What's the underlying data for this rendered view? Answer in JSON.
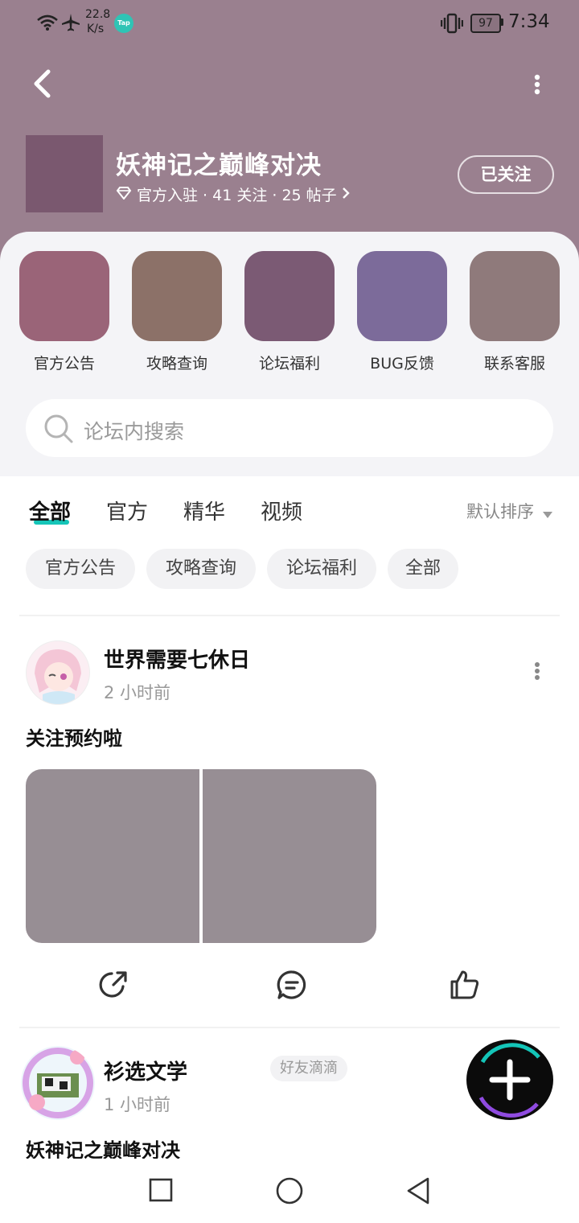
{
  "status_bar": {
    "net_speed_value": "22.8",
    "net_speed_unit": "K/s",
    "app_badge": "Tap",
    "battery": "97",
    "time": "7:34"
  },
  "header": {
    "forum_name": "妖神记之巅峰对决",
    "meta": "官方入驻 · 41 关注 · 25 帖子",
    "follow_button": "已关注"
  },
  "shortcuts": [
    {
      "label": "官方公告",
      "color": "#9a6478"
    },
    {
      "label": "攻略查询",
      "color": "#8c7168"
    },
    {
      "label": "论坛福利",
      "color": "#7b5a74"
    },
    {
      "label": "BUG反馈",
      "color": "#7c6b9a"
    },
    {
      "label": "联系客服",
      "color": "#8f7a7b"
    }
  ],
  "search": {
    "placeholder": "论坛内搜索"
  },
  "tabs": [
    {
      "label": "全部",
      "active": true
    },
    {
      "label": "官方",
      "active": false
    },
    {
      "label": "精华",
      "active": false
    },
    {
      "label": "视频",
      "active": false
    }
  ],
  "sort_label": "默认排序",
  "chips": [
    "官方公告",
    "攻略查询",
    "论坛福利",
    "全部"
  ],
  "posts": [
    {
      "author": "世界需要七休日",
      "time": "2 小时前",
      "title": "关注预约啦"
    },
    {
      "author": "衫选文学",
      "time": "1 小时前",
      "tag": "好友滴滴",
      "title": "妖神记之巅峰对决"
    }
  ],
  "colors": {
    "header_bg": "#9a808f",
    "accent": "#16c5b8",
    "image_placeholder": "#978e94"
  }
}
